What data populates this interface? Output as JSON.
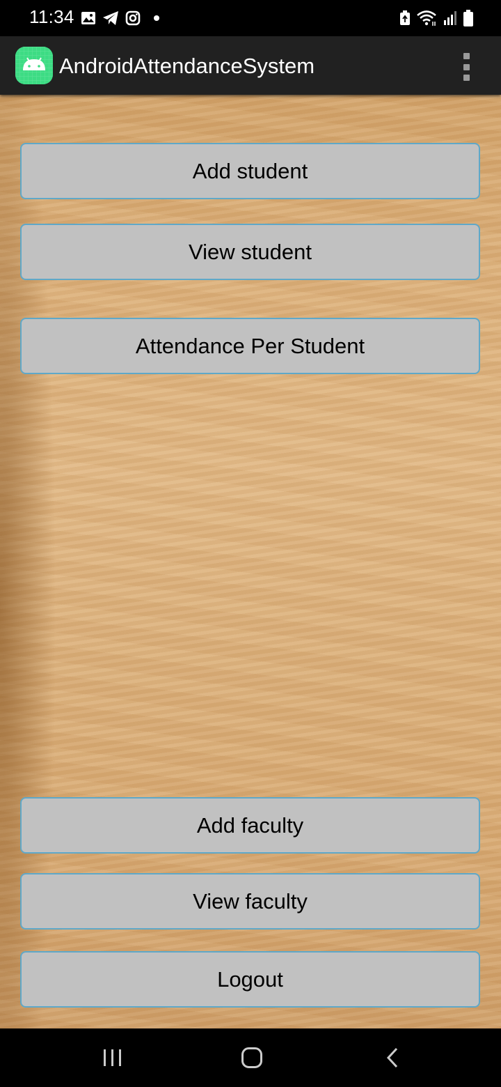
{
  "status_bar": {
    "time": "11:34",
    "left_icons": [
      "gallery-icon",
      "telegram-icon",
      "instagram-icon",
      "dot-icon"
    ],
    "right_icons": [
      "battery-saver-icon",
      "wifi-icon",
      "signal-icon",
      "battery-icon"
    ]
  },
  "app_bar": {
    "title": "AndroidAttendanceSystem",
    "app_icon": "android-icon",
    "menu_icon": "overflow-menu-icon"
  },
  "buttons": {
    "add_student": "Add student",
    "view_student": "View student",
    "attendance_per_student": "Attendance Per Student",
    "add_faculty": "Add faculty",
    "view_faculty": "View faculty",
    "logout": "Logout"
  },
  "nav_bar": {
    "icons": [
      "recent-apps-icon",
      "home-icon",
      "back-icon"
    ]
  },
  "colors": {
    "app_bar": "#212121",
    "button_bg": "#c1c1c1",
    "button_border": "#5fa8c8",
    "app_icon_bg": "#3ddc84",
    "background_wood": "#ddb27d"
  }
}
